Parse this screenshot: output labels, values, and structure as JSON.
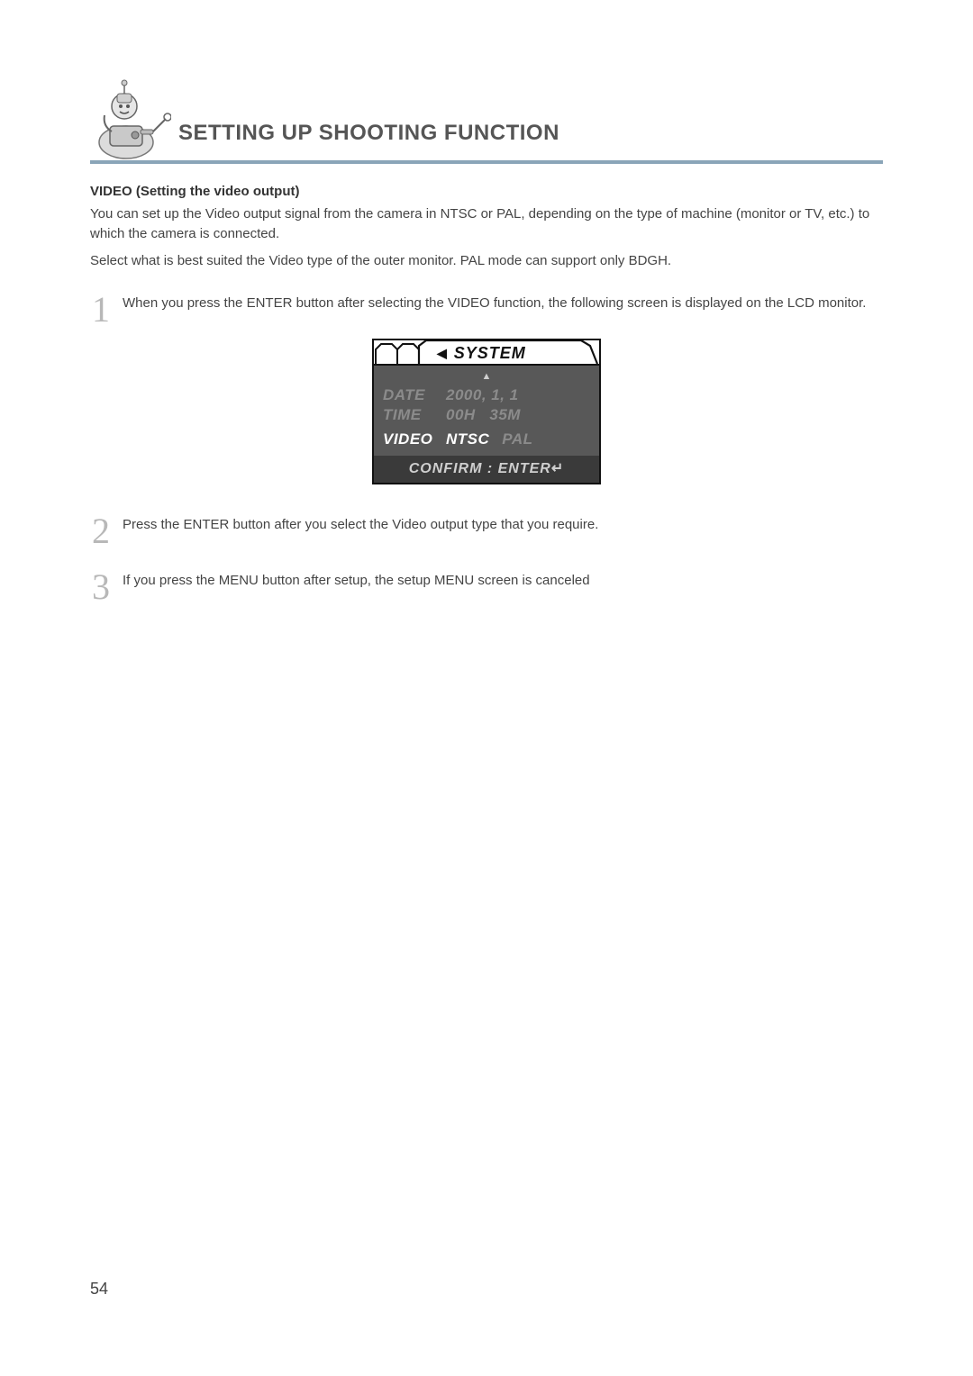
{
  "header": {
    "title": "SETTING UP SHOOTING FUNCTION"
  },
  "section": {
    "subtitle": "VIDEO (Setting the video output)",
    "p1": "You can set up the Video output signal from the camera in NTSC or PAL, depending on the type of machine (monitor or TV, etc.) to which the camera is connected.",
    "p2": "Select what is best suited the Video type of the outer monitor. PAL mode can support only BDGH."
  },
  "steps": [
    {
      "num": "1",
      "text": "When you press the ENTER button after selecting the VIDEO function, the following screen is displayed on the LCD monitor."
    },
    {
      "num": "2",
      "text": "Press the ENTER button after you select the Video output type that you require."
    },
    {
      "num": "3",
      "text": "If you press the MENU button after setup, the setup MENU screen is canceled"
    }
  ],
  "lcd": {
    "tab_title": "SYSTEM",
    "date_label": "DATE",
    "date_value": "2000,  1,  1",
    "time_label": "TIME",
    "time_value_h": "00H",
    "time_value_m": "35M",
    "video_label": "VIDEO",
    "video_opt1": "NTSC",
    "video_opt2": "PAL",
    "confirm": "CONFIRM : ENTER"
  },
  "page_number": "54"
}
